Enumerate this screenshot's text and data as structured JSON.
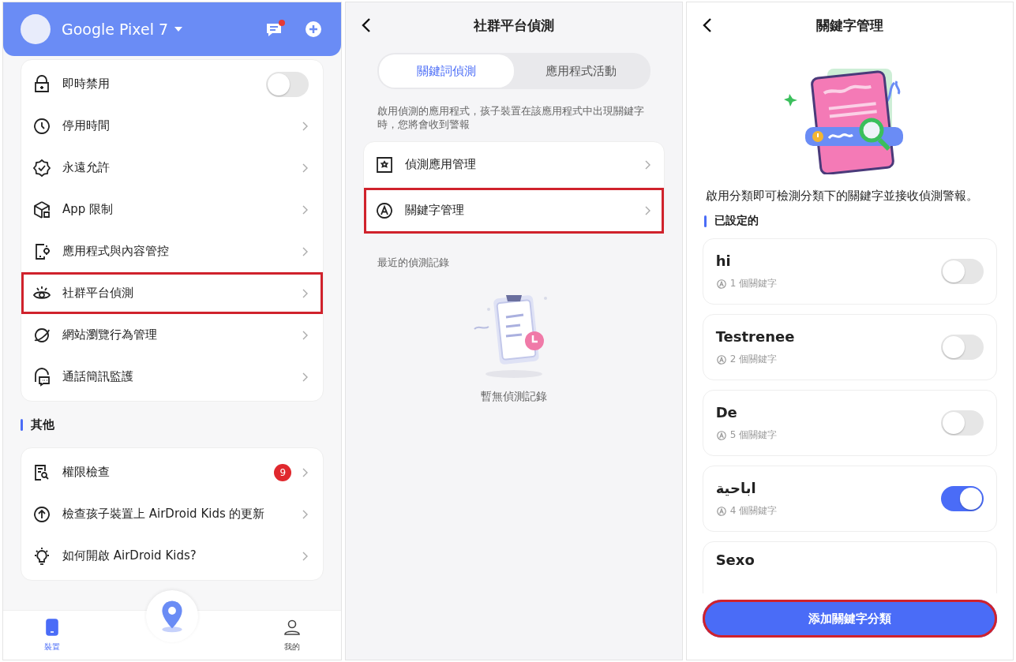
{
  "device_panel": {
    "device_name": "Google Pixel 7",
    "features": [
      {
        "kind": "toggle",
        "label": "即時禁用",
        "on": false,
        "highlighted": false
      },
      {
        "kind": "link",
        "label": "停用時間",
        "highlighted": false
      },
      {
        "kind": "link",
        "label": "永遠允許",
        "highlighted": false
      },
      {
        "kind": "link",
        "label": "App 限制",
        "highlighted": false
      },
      {
        "kind": "link",
        "label": "應用程式與內容管控",
        "highlighted": false
      },
      {
        "kind": "link",
        "label": "社群平台偵測",
        "highlighted": true
      },
      {
        "kind": "link",
        "label": "網站瀏覽行為管理",
        "highlighted": false
      },
      {
        "kind": "link",
        "label": "通話簡訊監護",
        "highlighted": false
      }
    ],
    "section_title": "其他",
    "others": [
      {
        "kind": "badge",
        "label": "權限檢查",
        "badge": "9"
      },
      {
        "kind": "link",
        "label": "檢查孩子裝置上 AirDroid Kids 的更新"
      },
      {
        "kind": "link",
        "label": "如何開啟 AirDroid Kids?"
      }
    ],
    "bottom_nav": [
      {
        "label": "裝置",
        "selected": true
      },
      {
        "label": "我的",
        "selected": false
      }
    ]
  },
  "detection_panel": {
    "title": "社群平台偵測",
    "tabs": [
      {
        "label": "關鍵詞偵測",
        "selected": true
      },
      {
        "label": "應用程式活動",
        "selected": false
      }
    ],
    "description": "啟用偵測的應用程式，孩子裝置在該應用程式中出現關鍵字時，您將會收到警報",
    "menu": [
      {
        "label": "偵測應用管理",
        "highlighted": false
      },
      {
        "label": "關鍵字管理",
        "highlighted": true
      }
    ],
    "recent_title": "最近的偵測記錄",
    "empty_text": "暫無偵測記錄"
  },
  "keyword_panel": {
    "title": "關鍵字管理",
    "description": "啟用分類即可檢測分類下的關鍵字並接收偵測警報。",
    "section_title": "已設定的",
    "categories": [
      {
        "name": "hi",
        "count": "1 個關鍵字",
        "on": false
      },
      {
        "name": "Testrenee",
        "count": "2 個關鍵字",
        "on": false
      },
      {
        "name": "De",
        "count": "5 個關鍵字",
        "on": false
      },
      {
        "name": "اباحية",
        "count": "4 個關鍵字",
        "on": true
      },
      {
        "name": "Sexo"
      }
    ],
    "add_button": {
      "label": "添加關鍵字分類",
      "highlighted": true
    }
  }
}
